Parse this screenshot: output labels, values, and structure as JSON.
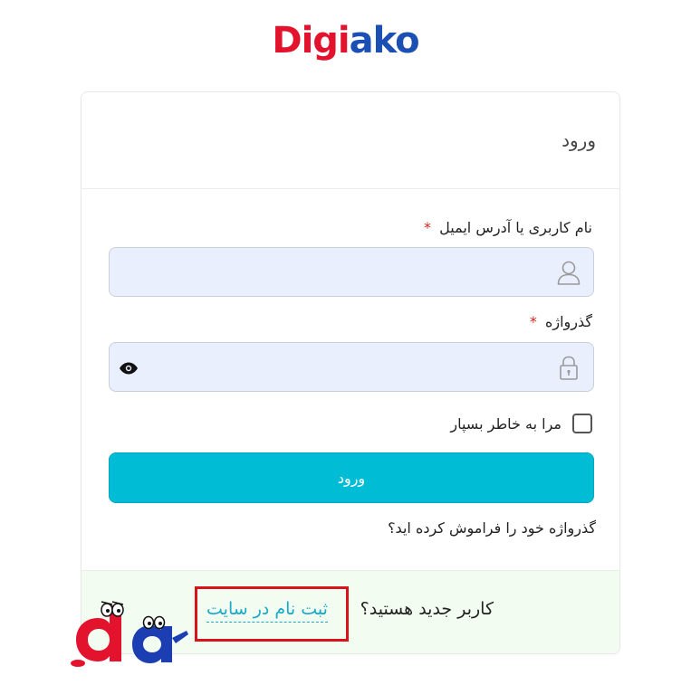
{
  "brand": {
    "logo_part1": "Digi",
    "logo_part2": "ako"
  },
  "header": {
    "title": "ورود"
  },
  "form": {
    "username_label": "نام کاربری یا آدرس ایمیل",
    "username_value": "",
    "password_label": "گذرواژه",
    "password_value": "",
    "required_mark": "*",
    "remember_label": "مرا به خاطر بسپار",
    "remember_checked": false,
    "submit_label": "ورود",
    "forgot_link": "گذرواژه خود را فراموش کرده اید؟"
  },
  "footer": {
    "question": "کاربر جدید هستید؟",
    "register_link": "ثبت نام در سایت"
  },
  "icons": {
    "username_field": "user-icon",
    "password_field": "lock-icon",
    "show_password": "eye-icon"
  },
  "colors": {
    "primary_button": "#00bcd4",
    "link": "#17a9c9",
    "required": "#d0261d",
    "input_bg": "#e9effd",
    "footer_bg": "#f3fcf1",
    "highlight_box": "#d9131b",
    "logo_red": "#e3132d",
    "logo_blue": "#1b4fb3"
  }
}
